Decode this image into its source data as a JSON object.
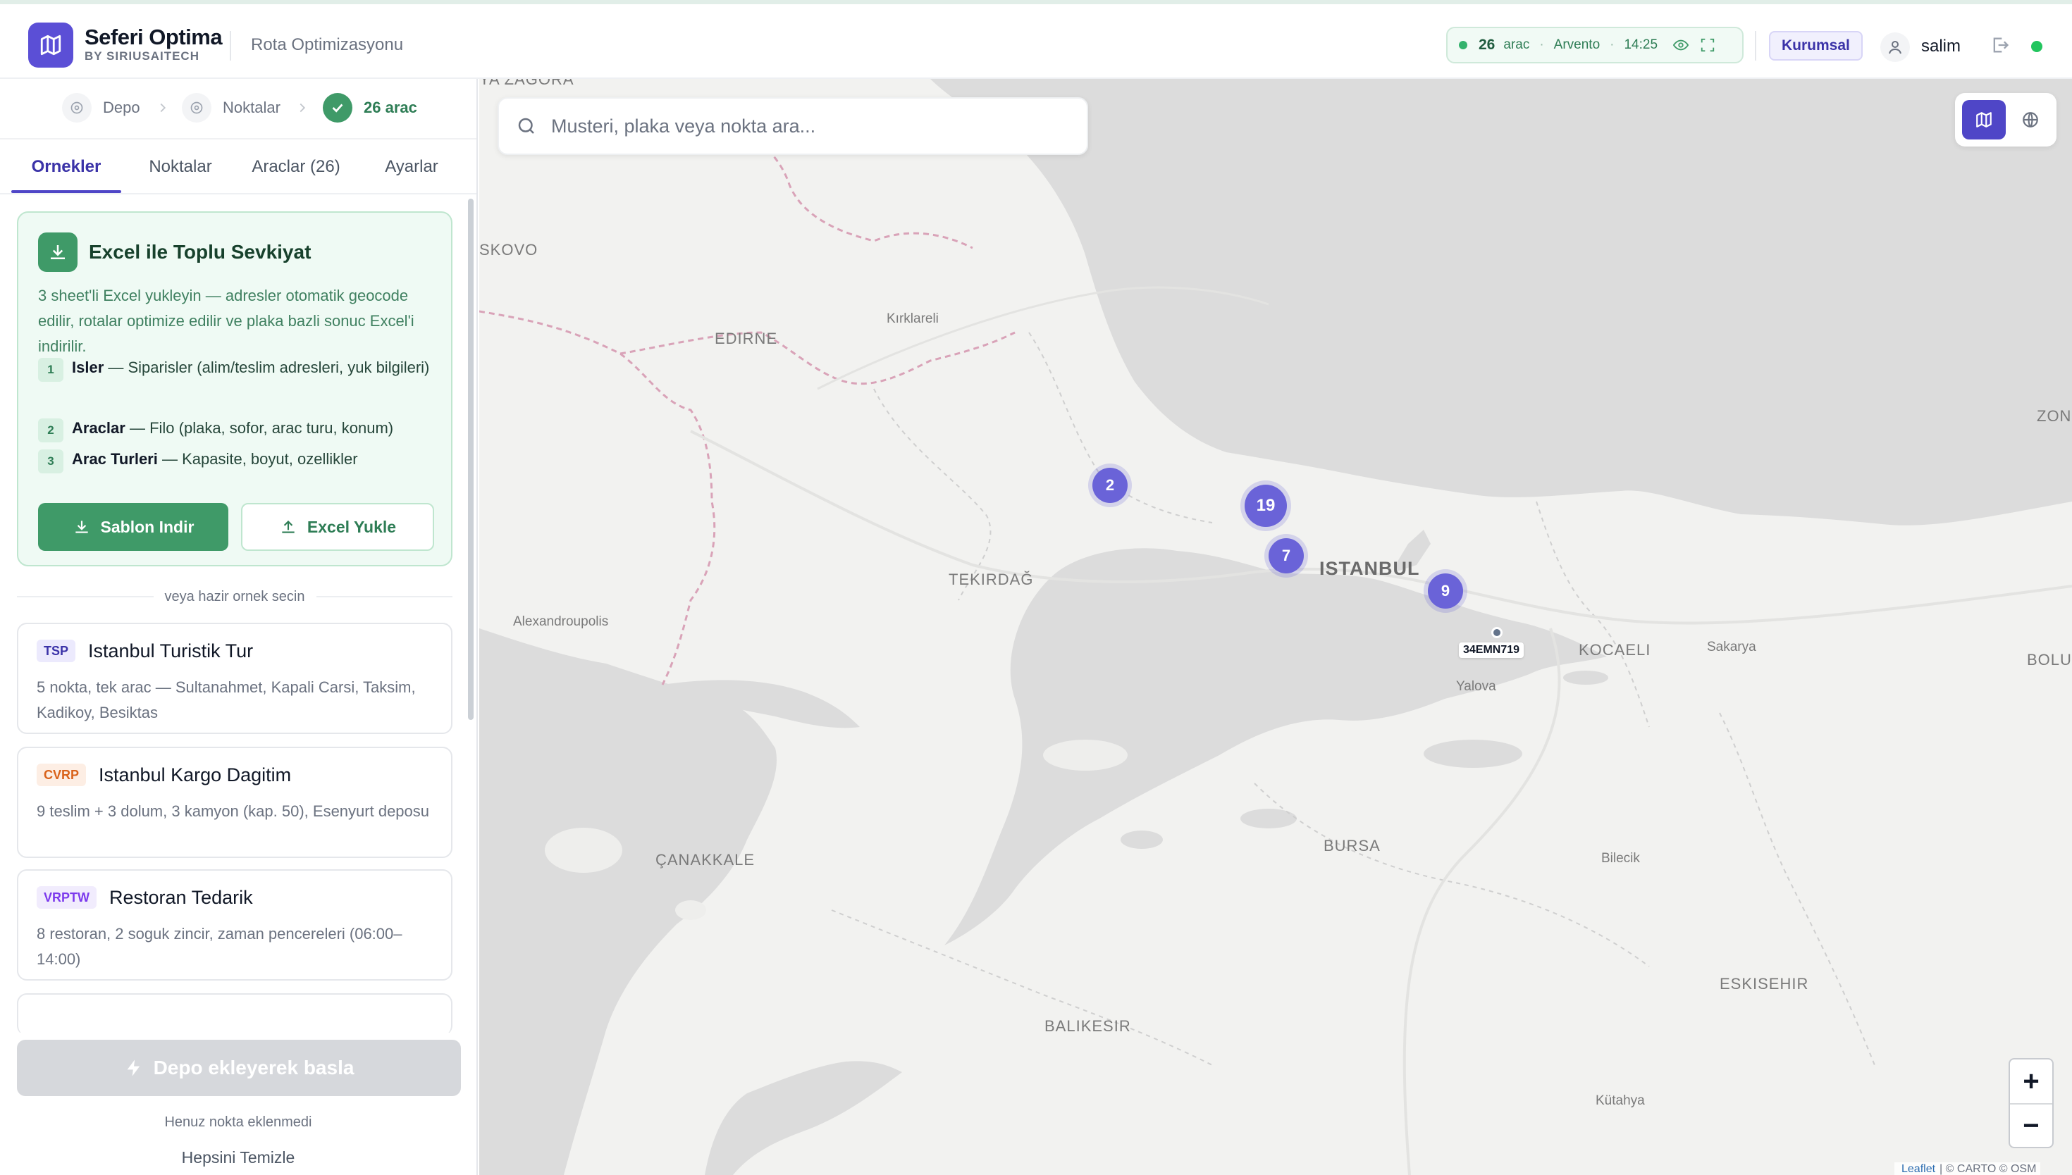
{
  "app": {
    "name": "Seferi Optima",
    "by": "BY SIRIUSAITECH",
    "page_title": "Rota Optimizasyonu"
  },
  "status": {
    "count": "26",
    "count_label": "arac",
    "provider": "Arvento",
    "time": "14:25",
    "dot_color": "#34b26d"
  },
  "plan_badge": "Kurumsal",
  "user": {
    "name": "salim"
  },
  "steps": [
    {
      "label": "Depo",
      "state": "pending"
    },
    {
      "label": "Noktalar",
      "state": "pending"
    },
    {
      "label": "26 arac",
      "state": "done"
    }
  ],
  "tabs": [
    {
      "label": "Ornekler",
      "active": true
    },
    {
      "label": "Noktalar",
      "active": false
    },
    {
      "label": "Araclar (26)",
      "active": false
    },
    {
      "label": "Ayarlar",
      "active": false
    }
  ],
  "excel": {
    "title": "Excel ile Toplu Sevkiyat",
    "description": "3 sheet'li Excel yukleyin — adresler otomatik geocode edilir, rotalar optimize edilir ve plaka bazli sonuc Excel'i indirilir.",
    "sheets": [
      {
        "num": "1",
        "name": "Isler",
        "desc": " — Siparisler (alim/teslim adresleri, yuk bilgileri)"
      },
      {
        "num": "2",
        "name": "Araclar",
        "desc": " — Filo (plaka, sofor, arac turu, konum)"
      },
      {
        "num": "3",
        "name": "Arac Turleri",
        "desc": " — Kapasite, boyut, ozellikler"
      }
    ],
    "download_label": "Sablon Indir",
    "upload_label": "Excel Yukle"
  },
  "samples_divider": "veya hazir ornek secin",
  "samples": [
    {
      "badge": "TSP",
      "title": "Istanbul Turistik Tur",
      "desc": "5 nokta, tek arac — Sultanahmet, Kapali Carsi, Taksim, Kadikoy, Besiktas"
    },
    {
      "badge": "CVRP",
      "title": "Istanbul Kargo Dagitim",
      "desc": "9 teslim + 3 dolum, 3 kamyon (kap. 50), Esenyurt deposu"
    },
    {
      "badge": "VRPTW",
      "title": "Restoran Tedarik",
      "desc": "8 restoran, 2 soguk zincir, zaman pencereleri (06:00–14:00)"
    }
  ],
  "start_button": "Depo ekleyerek basla",
  "empty_note": "Henuz nokta eklenmedi",
  "clear_all": "Hepsini Temizle",
  "map": {
    "search_placeholder": "Musteri, plaka veya nokta ara...",
    "zoom_in": "+",
    "zoom_out": "−",
    "attribution_leaflet": "Leaflet",
    "attribution_rest": "| © CARTO © OSM",
    "clusters": [
      "2",
      "19",
      "7",
      "9"
    ],
    "vehicle_plate": "34EMN719",
    "places": {
      "zagora": "YA ZAGORA",
      "skovo": "SKOVO",
      "kirklareli": "Kırklareli",
      "edirne": "EDIRNE",
      "tekirdag": "TEKIRDAĞ",
      "alexandroupolis": "Alexandroupolis",
      "istanbul": "ISTANBUL",
      "kocaeli": "KOCAELI",
      "sakarya": "Sakarya",
      "yalova": "Yalova",
      "bolu": "BOLU",
      "zon": "ZON",
      "canakkale": "ÇANAKKALE",
      "bursa": "BURSA",
      "bilecik": "Bilecik",
      "balikesir": "BALIKESIR",
      "eskisehir": "ESKISEHIR",
      "kutahya": "Kütahya"
    }
  }
}
